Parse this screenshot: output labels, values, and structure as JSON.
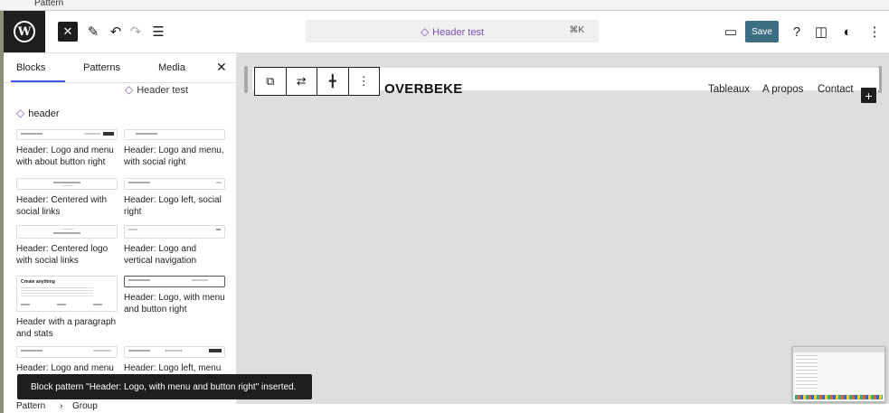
{
  "window": {
    "top_label": "Pattern"
  },
  "toolbar": {
    "close_icon": "close-icon",
    "document_title": "Header test",
    "shortcut": "⌘K",
    "save_label": "Save"
  },
  "sidebar": {
    "tabs": [
      "Blocks",
      "Patterns",
      "Media"
    ],
    "active_tab": "Blocks",
    "search_result_left": "header",
    "search_result_right": "Header test",
    "patterns": [
      "Header: Logo and menu with about button right",
      "Header: Logo and menu, with social right",
      "Header: Centered with social links",
      "Header: Logo left, social right",
      "Header: Centered logo with social links",
      "Header: Logo and vertical navigation",
      "Header with a paragraph and stats",
      "Header: Logo, with menu and button right",
      "Header: Logo and menu",
      "Header: Logo left, menu centered, button right"
    ],
    "thumb_text": "Create anything"
  },
  "canvas": {
    "site_title": "OVERBEKE",
    "nav": [
      "Tableaux",
      "A propos",
      "Contact"
    ]
  },
  "snackbar": {
    "message": "Block pattern \"Header: Logo, with menu and button right\" inserted."
  },
  "breadcrumb": {
    "items": [
      "Pattern",
      "Group"
    ],
    "separator": "›"
  },
  "colors": {
    "accent": "#3858e9",
    "save_button": "#3c6e84",
    "doc_title": "#7d4fb8"
  }
}
